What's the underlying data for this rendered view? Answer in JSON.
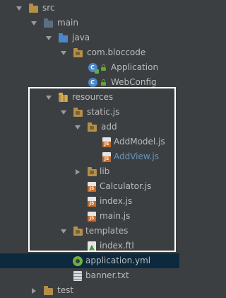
{
  "tree": {
    "src": {
      "label": "src"
    },
    "main": {
      "label": "main"
    },
    "java": {
      "label": "java"
    },
    "package": {
      "label": "com.bloccode"
    },
    "application_class": {
      "label": "Application"
    },
    "webconfig_class": {
      "label": "WebConfig"
    },
    "resources": {
      "label": "resources"
    },
    "static_js": {
      "label": "static.js"
    },
    "add": {
      "label": "add"
    },
    "addmodel": {
      "label": "AddModel.js"
    },
    "addview": {
      "label": "AddView.js"
    },
    "lib": {
      "label": "lib"
    },
    "calculator": {
      "label": "Calculator.js"
    },
    "index_js": {
      "label": "index.js"
    },
    "main_js": {
      "label": "main.js"
    },
    "templates": {
      "label": "templates"
    },
    "index_ftl": {
      "label": "index.ftl"
    },
    "application_yml": {
      "label": "application.yml"
    },
    "banner": {
      "label": "banner.txt"
    },
    "test": {
      "label": "test"
    }
  },
  "colors": {
    "background": "#3c3f41",
    "selection": "#0d293e",
    "text": "#bbbbbb",
    "modified_text": "#6897bb",
    "highlight_border": "#ffffff"
  }
}
